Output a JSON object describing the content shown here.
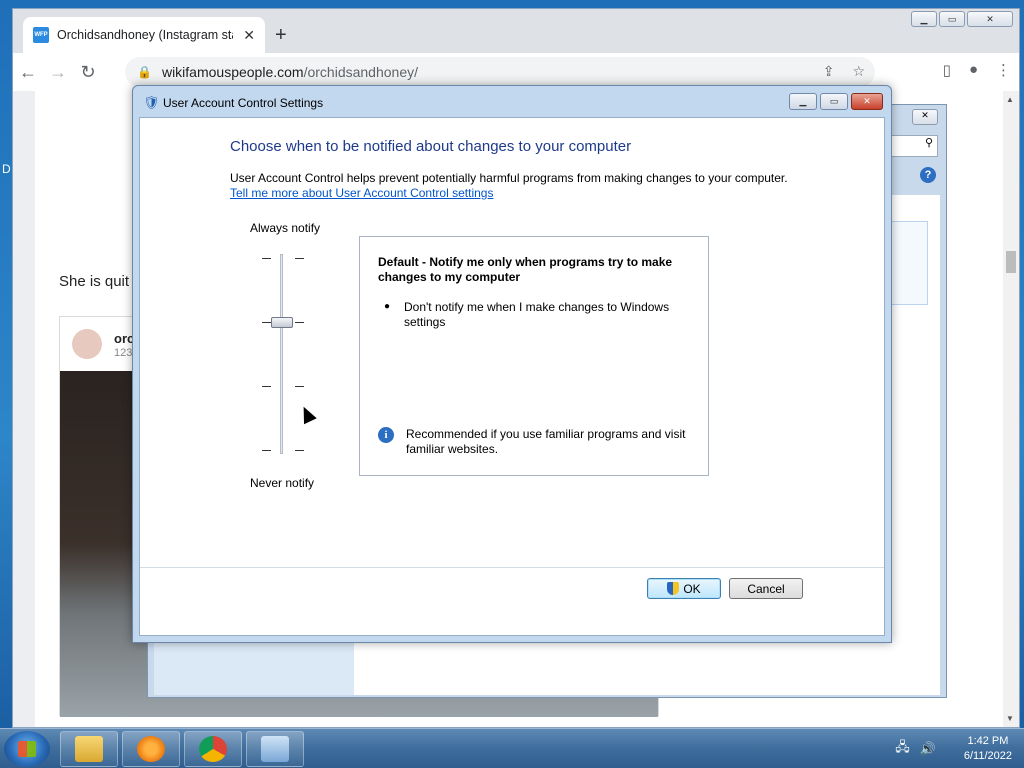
{
  "desktop": {
    "edge_letter": "D"
  },
  "browser": {
    "tab": {
      "favicon_text": "WFP",
      "title": "Orchidsandhoney (Instagram sta",
      "close": "✕"
    },
    "new_tab": "+",
    "window_controls": {
      "minimize": "▁",
      "maximize": "▭",
      "close": "✕"
    },
    "nav": {
      "back": "←",
      "forward": "→",
      "reload": "↻"
    },
    "url_host": "wikifamouspeople.com",
    "url_path": "/orchidsandhoney/",
    "omni_icons": {
      "share": "⇪",
      "bookmark": "☆"
    },
    "toolbar_right": {
      "side_panel": "▯",
      "profile": "●",
      "menu": "⋮"
    }
  },
  "webpage": {
    "text": "She is quit",
    "insta": {
      "name": "orc",
      "sub": "123"
    },
    "scrollbar": {
      "up": "▲",
      "down": "▼"
    }
  },
  "control_panel": {
    "close": "✕",
    "search_icon": "⚲",
    "help": "?"
  },
  "uac": {
    "window_title": "User Account Control Settings",
    "controls": {
      "minimize": "▁",
      "maximize": "▭",
      "close": "✕"
    },
    "heading": "Choose when to be notified about changes to your computer",
    "description": "User Account Control helps prevent potentially harmful programs from making changes to your computer.",
    "link": "Tell me more about User Account Control settings",
    "slider_top_label": "Always notify",
    "slider_bottom_label": "Never notify",
    "slider_level": 3,
    "slider_levels": 4,
    "info_title": "Default - Notify me only when programs try to make changes to my computer",
    "info_bullet": "Don't notify me when I make changes to Windows settings",
    "info_note": "Recommended if you use familiar programs and visit familiar websites.",
    "info_icon": "i",
    "ok_label": "OK",
    "cancel_label": "Cancel"
  },
  "taskbar": {
    "clock_time": "1:42 PM",
    "clock_date": "6/11/2022",
    "tray": {
      "network": "🖧",
      "volume": "🔊"
    }
  }
}
